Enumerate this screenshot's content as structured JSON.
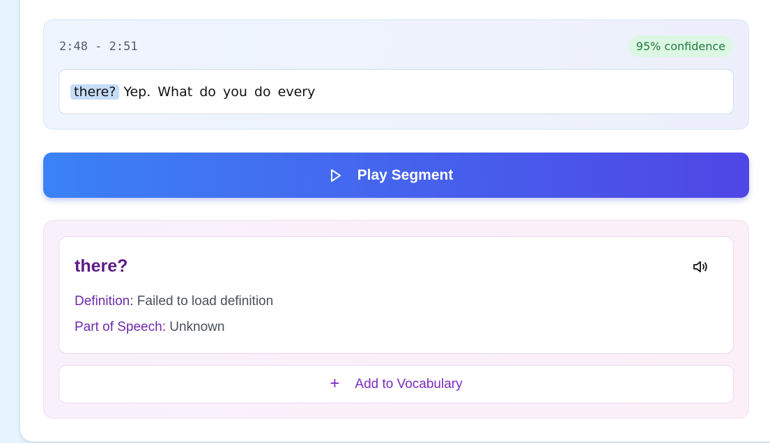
{
  "transcript": {
    "time_range": "2:48 - 2:51",
    "confidence": "95% confidence",
    "highlighted_word": "there?",
    "text": "Yep. What do you do every"
  },
  "play_button": {
    "label": "Play Segment",
    "icon": "play-icon"
  },
  "definition": {
    "word": "there?",
    "definition_label": "Definition:",
    "definition_value": "Failed to load definition",
    "pos_label": "Part of Speech:",
    "pos_value": "Unknown",
    "speaker_icon": "speaker-icon"
  },
  "add_button": {
    "label": "Add to Vocabulary",
    "icon": "plus-icon"
  },
  "colors": {
    "play_gradient_start": "#3b82f6",
    "play_gradient_end": "#4f46e5",
    "confidence_bg": "#dcf7e4",
    "confidence_text": "#1f7a3f",
    "word_title": "#5b1a85",
    "label_purple": "#6d2aa8"
  }
}
